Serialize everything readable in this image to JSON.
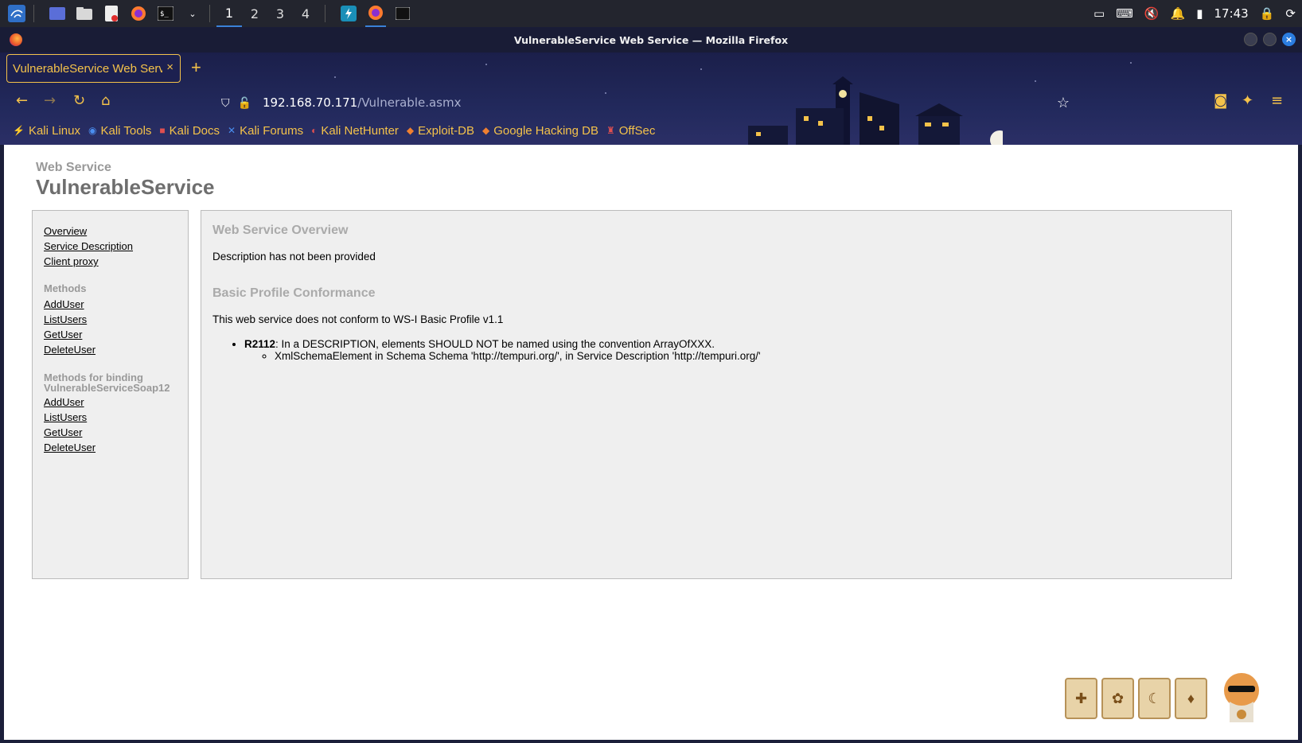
{
  "taskbar": {
    "workspaces": [
      "1",
      "2",
      "3",
      "4"
    ],
    "clock": "17:43"
  },
  "window": {
    "title": "VulnerableService Web Service — Mozilla Firefox"
  },
  "tab": {
    "title": "VulnerableService Web Servi",
    "close": "×",
    "new": "+"
  },
  "url": {
    "host": "192.168.70.171",
    "path": "/Vulnerable.asmx"
  },
  "bookmarks": [
    "Kali Linux",
    "Kali Tools",
    "Kali Docs",
    "Kali Forums",
    "Kali NetHunter",
    "Exploit-DB",
    "Google Hacking DB",
    "OffSec"
  ],
  "page": {
    "subtitle": "Web Service",
    "title": "VulnerableService",
    "nav": {
      "overview": "Overview",
      "service_description": "Service Description",
      "client_proxy": "Client proxy",
      "methods_heading": "Methods",
      "methods": [
        "AddUser",
        "ListUsers",
        "GetUser",
        "DeleteUser"
      ],
      "binding_heading": "Methods for binding",
      "binding_name": "VulnerableServiceSoap12",
      "binding_methods": [
        "AddUser",
        "ListUsers",
        "GetUser",
        "DeleteUser"
      ]
    },
    "main": {
      "overview_title": "Web Service Overview",
      "overview_text": "Description has not been provided",
      "conformance_title": "Basic Profile Conformance",
      "conformance_text": "This web service does not conform to WS-I Basic Profile v1.1",
      "rule_id": "R2112",
      "rule_text": ": In a DESCRIPTION, elements SHOULD NOT be named using the convention ArrayOfXXX.",
      "rule_detail": "XmlSchemaElement in Schema Schema 'http://tempuri.org/', in Service Description 'http://tempuri.org/'"
    }
  },
  "colors": {
    "accent": "#f4c24a",
    "nav_bg": "#efefef",
    "heading_gray": "#aaaaaa"
  }
}
